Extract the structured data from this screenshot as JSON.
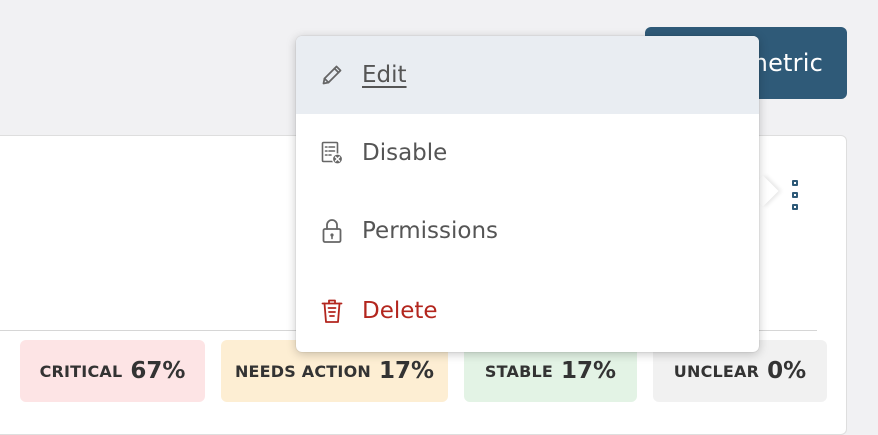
{
  "header": {
    "metric_button_label": "metric"
  },
  "menu": {
    "edit_label": "Edit",
    "disable_label": "Disable",
    "permissions_label": "Permissions",
    "delete_label": "Delete"
  },
  "stats": [
    {
      "label": "CRITICAL",
      "value": "67%"
    },
    {
      "label": "NEEDS ACTION",
      "value": "17%"
    },
    {
      "label": "STABLE",
      "value": "17%"
    },
    {
      "label": "UNCLEAR",
      "value": "0%"
    }
  ],
  "colors": {
    "primary": "#2f5a78",
    "danger": "#b3261e",
    "critical_bg": "#fde4e5",
    "needs_action_bg": "#fdeed3",
    "stable_bg": "#e3f3e5",
    "unclear_bg": "#f1f1f1"
  },
  "icons": {
    "edit": "pencil-icon",
    "disable": "list-x-icon",
    "permissions": "lock-icon",
    "delete": "trash-icon",
    "more": "kebab-icon"
  }
}
